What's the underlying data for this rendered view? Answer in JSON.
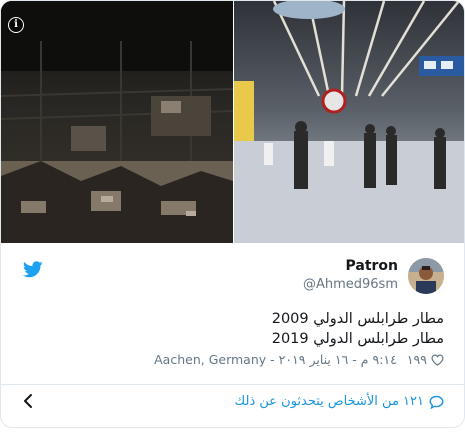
{
  "tweet": {
    "author_name": "Patron",
    "author_handle": "@Ahmed96sm",
    "text_line_1": "مطار طرابلس الدولي 2009",
    "text_line_2": "مطار طرابلس الدولي 2019",
    "likes": "١٩٩",
    "timestamp": "٩:١٤ م - ١٦ يناير ٢٠١٩",
    "location": "Aachen, Germany",
    "footer_text": "١٢١ من الأشخاص يتحدثون عن ذلك"
  },
  "icons": {
    "info": "info-icon",
    "bird": "twitter-bird-icon",
    "heart": "heart-icon",
    "comment": "comment-bubble-icon",
    "chevron": "chevron-left-icon"
  },
  "colors": {
    "twitter_blue": "#1da1f2",
    "link_blue": "#1b95e0",
    "text_gray": "#657786",
    "border": "#e1e8ed"
  }
}
